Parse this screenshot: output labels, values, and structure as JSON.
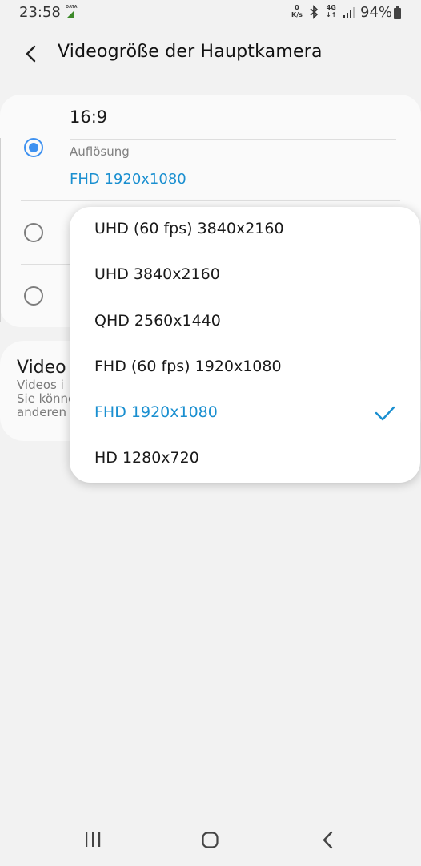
{
  "status_bar": {
    "time": "23:58",
    "data_label": "DATA",
    "net_speed_value": "0",
    "net_speed_unit": "K/s",
    "network_type": "4G",
    "battery_percent": "94%",
    "battery_level": 0.94
  },
  "header": {
    "title": "Videogröße der Hauptkamera"
  },
  "card": {
    "ratio_label": "16:9",
    "resolution_caption": "Auflösung",
    "resolution_value": "FHD 1920x1080",
    "radio_selected_index": 0
  },
  "card2": {
    "title": "Video",
    "desc_line1": "Videos i",
    "desc_line2": "Sie könne",
    "desc_line3": "anderen"
  },
  "dropdown": {
    "options": [
      "UHD (60 fps) 3840x2160",
      "UHD 3840x2160",
      "QHD 2560x1440",
      "FHD (60 fps) 1920x1080",
      "FHD 1920x1080",
      "HD 1280x720"
    ],
    "selected_index": 4
  },
  "colors": {
    "accent_blue": "#1a8fd0",
    "radio_blue": "#3e91f0",
    "background": "#f2f2f2"
  }
}
